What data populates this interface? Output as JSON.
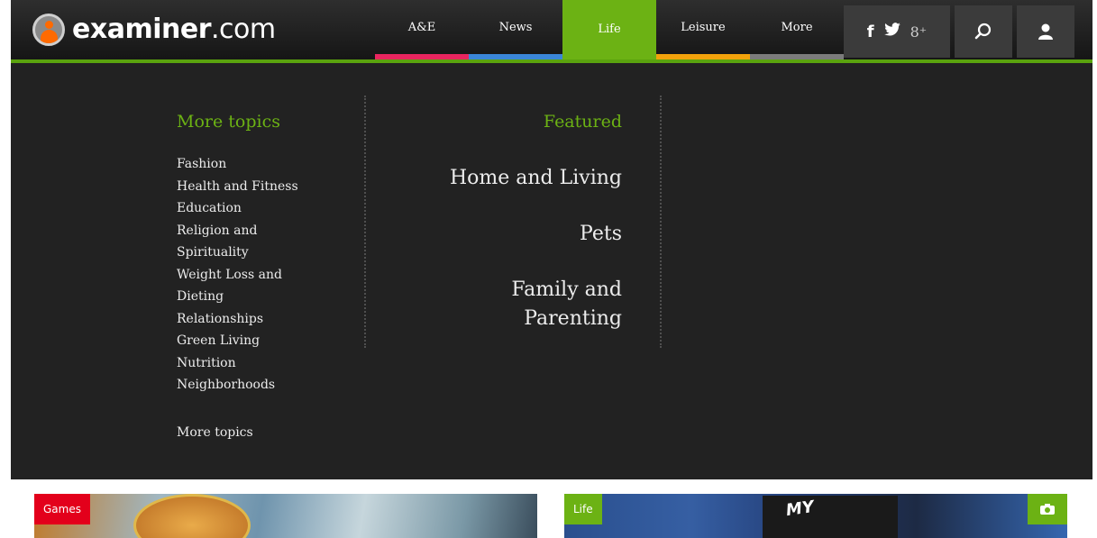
{
  "logo": {
    "strong": "examiner",
    "light": ".com"
  },
  "nav": {
    "tabs": [
      {
        "label": "A&E",
        "color": "#e8255f"
      },
      {
        "label": "News",
        "color": "#3a86d8"
      },
      {
        "label": "Life",
        "color": "#6cb214",
        "active": true
      },
      {
        "label": "Leisure",
        "color": "#f2a20b"
      },
      {
        "label": "More",
        "color": "#7b7b7b"
      }
    ],
    "social_icons": [
      "facebook-icon",
      "twitter-icon",
      "google-plus-icon"
    ],
    "social_glyphs": {
      "facebook": "f",
      "twitter": "♥",
      "googleplus": "8⁺"
    },
    "search_icon": "search-icon",
    "user_icon": "user-icon"
  },
  "dropdown": {
    "more_topics_heading": "More topics",
    "topics": [
      "Fashion",
      "Health and Fitness",
      "Education",
      "Religion and",
      "Spirituality",
      "Weight Loss and",
      "Dieting",
      "Relationships",
      "Green Living",
      "Nutrition",
      "Neighborhoods"
    ],
    "more_topics_link": "More topics",
    "featured_heading": "Featured",
    "featured": [
      "Home and Living",
      "Pets",
      "Family and Parenting"
    ]
  },
  "cards": [
    {
      "badge": "Games",
      "badge_color": "#e3001b"
    },
    {
      "badge": "Life",
      "badge_color": "#6cb214",
      "camera_icon": "camera-icon"
    }
  ],
  "colors": {
    "accent": "#6cb214",
    "bar_bg": "#1e1e1e",
    "menu_bg": "#222222"
  }
}
